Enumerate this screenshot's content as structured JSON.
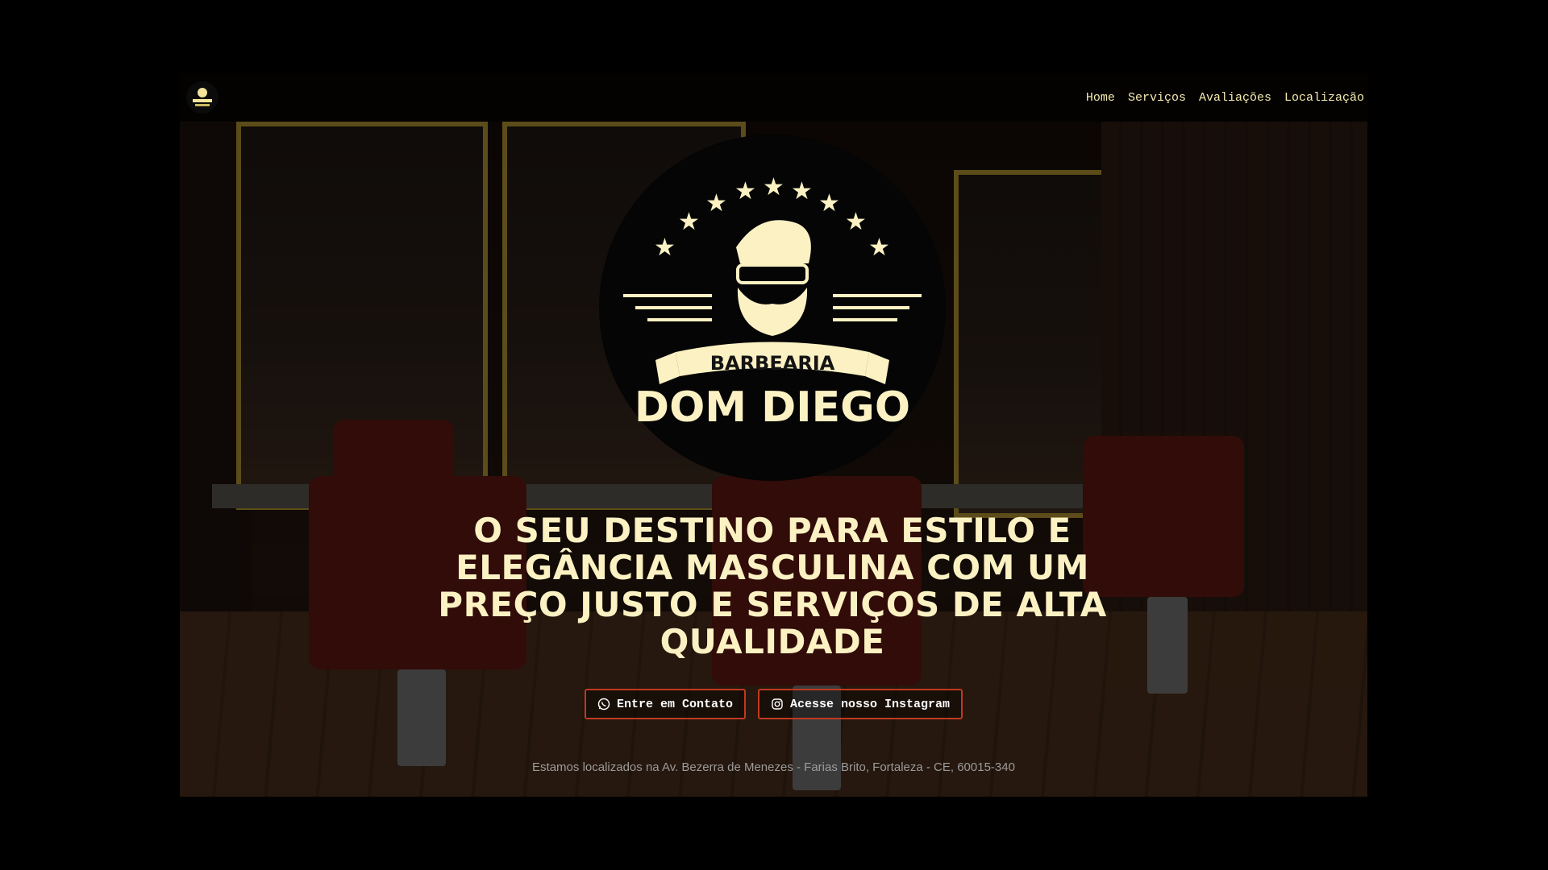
{
  "nav": {
    "logo_icon": "barbershop-logo-icon",
    "links": [
      "Home",
      "Serviços",
      "Avaliações",
      "Localização"
    ]
  },
  "hero": {
    "logo_text_top": "BARBEARIA",
    "logo_text_bottom": "DOM DIEGO",
    "title": "O SEU DESTINO PARA ESTILO E ELEGÂNCIA MASCULINA COM UM PREÇO JUSTO E SERVIÇOS DE ALTA QUALIDADE",
    "buttons": {
      "contact": {
        "label": "Entre em Contato",
        "icon": "whatsapp-icon"
      },
      "instagram": {
        "label": "Acesse nosso Instagram",
        "icon": "instagram-icon"
      }
    },
    "address": "Estamos localizados na Av. Bezerra de Menezes - Farias Brito, Fortaleza - CE, 60015-340"
  },
  "colors": {
    "accent_cream": "#fbf1c2",
    "button_border": "#c0391f",
    "nav_text": "#f5ecb0"
  }
}
